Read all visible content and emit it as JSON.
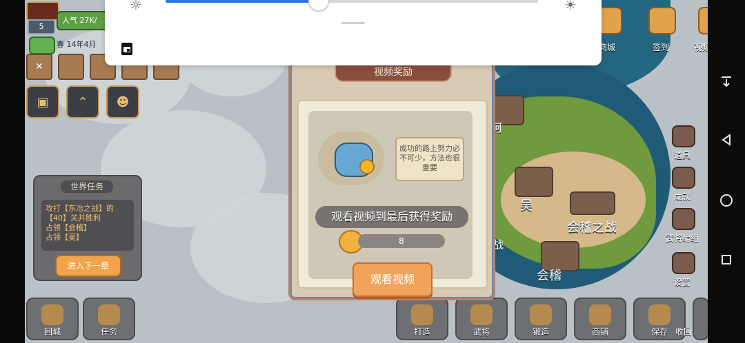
{
  "hud": {
    "level": "5",
    "population": "人气 27K/",
    "date": "春 14年4月"
  },
  "system_overlay": {
    "brightness_percent": 0.41,
    "icons": [
      "sun-min-icon",
      "sun-max-icon",
      "calendar-icon"
    ]
  },
  "right_top_buttons": [
    {
      "label": "商城",
      "icon": "shop-icon"
    },
    {
      "label": "签到",
      "icon": "checkin-icon"
    },
    {
      "label": "视频奖励",
      "icon": "video-reward-icon"
    }
  ],
  "right_side_buttons": [
    {
      "label": "道具",
      "icon": "items-icon"
    },
    {
      "label": "成就",
      "icon": "achievement-icon"
    },
    {
      "label": "武将编组",
      "icon": "general-team-icon"
    },
    {
      "label": "设置",
      "icon": "settings-icon"
    }
  ],
  "bottom_left": [
    {
      "label": "回城",
      "icon": "return-city-icon"
    },
    {
      "label": "任务",
      "icon": "task-icon"
    }
  ],
  "bottom_right": [
    {
      "label": "打造",
      "icon": "forge-icon"
    },
    {
      "label": "武将",
      "icon": "general-icon"
    },
    {
      "label": "锻造",
      "icon": "smithing-icon"
    },
    {
      "label": "商铺",
      "icon": "store-icon"
    },
    {
      "label": "保存",
      "icon": "save-icon"
    },
    {
      "label": "收回",
      "icon": "collapse-icon"
    }
  ],
  "world_task": {
    "title": "世界任务",
    "text": "攻打【东冶之战】的【40】关并胜利\n占领【会稽】\n占领【吴】",
    "next_button": "进入下一章"
  },
  "map_labels": {
    "wu": "吴",
    "huiji": "会稽",
    "huiji_battle": "会稽之战",
    "right_a": "阿",
    "left_fragment": "战"
  },
  "modal": {
    "header": "视频奖励",
    "bubble": "成功的路上努力必不可少，方法也很重要",
    "banner": "观看视频到最后获得奖励",
    "reward_amount": "8",
    "watch_button": "观看视频"
  },
  "android_nav": {
    "icons": [
      "down-arrow-icon",
      "back-icon",
      "home-icon",
      "recents-icon"
    ]
  }
}
